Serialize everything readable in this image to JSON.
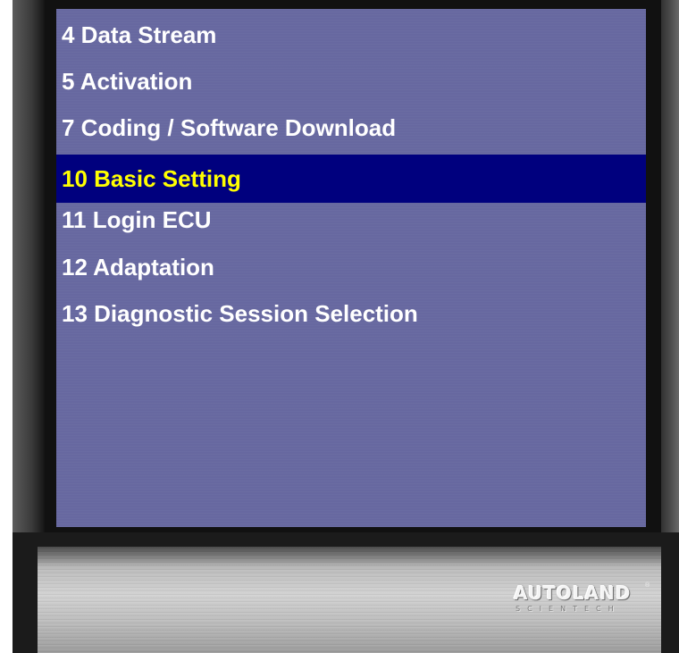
{
  "menu": {
    "items": [
      {
        "label": "4 Data Stream",
        "selected": false
      },
      {
        "label": "5 Activation",
        "selected": false
      },
      {
        "label": "7 Coding / Software Download",
        "selected": false
      },
      {
        "label": "10 Basic Setting",
        "selected": true
      },
      {
        "label": "11 Login ECU",
        "selected": false
      },
      {
        "label": "12 Adaptation",
        "selected": false
      },
      {
        "label": "13 Diagnostic Session Selection",
        "selected": false
      }
    ]
  },
  "brand": {
    "name": "AUTOLAND",
    "registered": "®",
    "subtitle": "SCIENTECH"
  },
  "colors": {
    "screen_background": "#6768a0",
    "selection_background": "#00007e",
    "selected_text": "#ffff00",
    "menu_text": "#ffffff",
    "device_body": "#2a2a2a",
    "silver_panel": "#c8c8c8"
  }
}
